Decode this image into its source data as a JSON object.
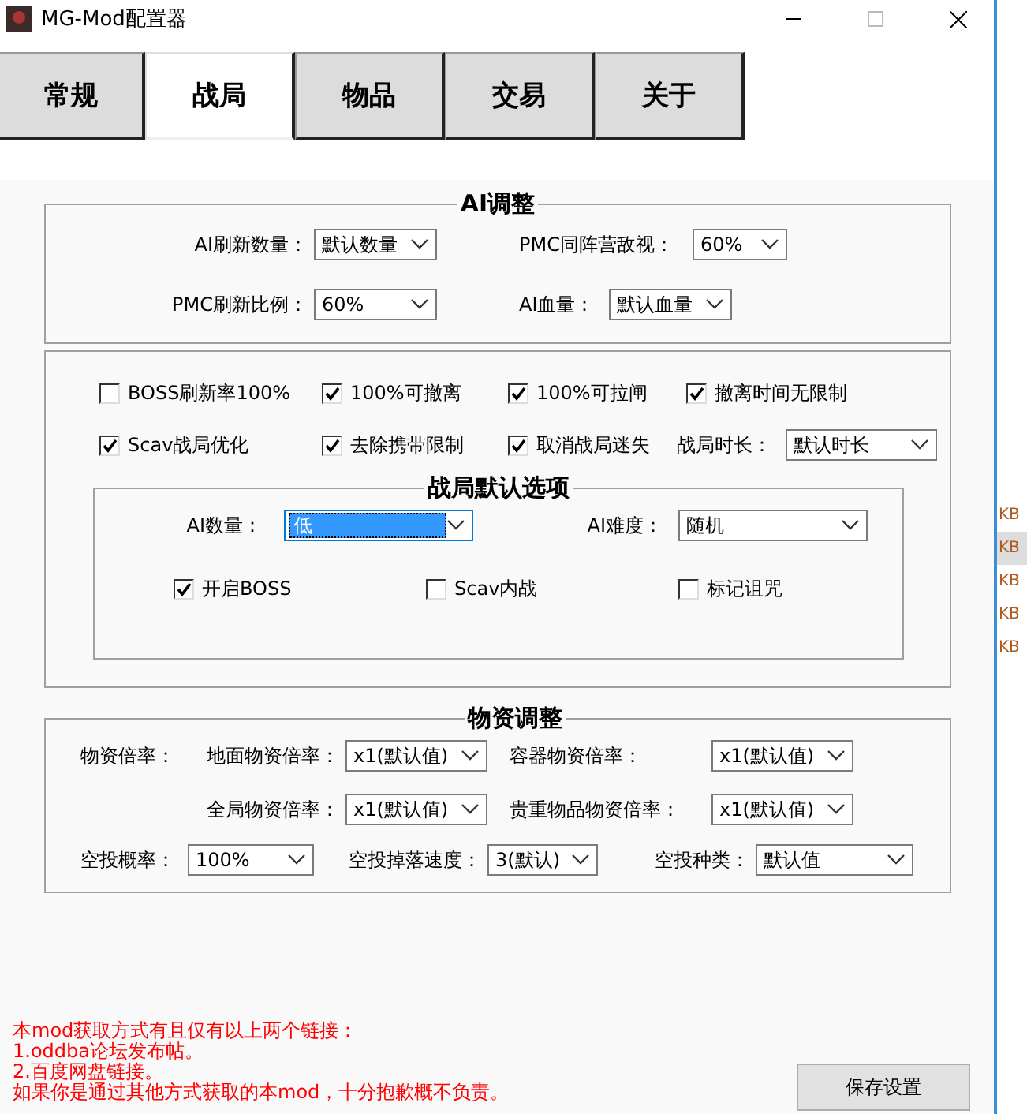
{
  "window": {
    "title": "MG-Mod配置器"
  },
  "tabs": [
    {
      "label": "常规",
      "selected": false
    },
    {
      "label": "战局",
      "selected": true
    },
    {
      "label": "物品",
      "selected": false
    },
    {
      "label": "交易",
      "selected": false
    },
    {
      "label": "关于",
      "selected": false
    }
  ],
  "ai_group": {
    "title": "AI调整",
    "fields": [
      {
        "label": "AI刷新数量：",
        "value": "默认数量"
      },
      {
        "label": "PMC同阵营敌视：",
        "value": "60%"
      },
      {
        "label": "PMC刷新比例：",
        "value": "60%"
      },
      {
        "label": "AI血量：",
        "value": "默认血量"
      }
    ]
  },
  "options_group": {
    "checkboxes": [
      {
        "label": "BOSS刷新率100%",
        "checked": false
      },
      {
        "label": "100%可撤离",
        "checked": true
      },
      {
        "label": "100%可拉闸",
        "checked": true
      },
      {
        "label": "撤离时间无限制",
        "checked": true
      },
      {
        "label": "Scav战局优化",
        "checked": true
      },
      {
        "label": "去除携带限制",
        "checked": true
      },
      {
        "label": "取消战局迷失",
        "checked": true
      }
    ],
    "duration": {
      "label": "战局时长：",
      "value": "默认时长"
    },
    "defaults": {
      "title": "战局默认选项",
      "fields": [
        {
          "label": "AI数量：",
          "value": "低",
          "focused": true
        },
        {
          "label": "AI难度：",
          "value": "随机",
          "focused": false
        }
      ],
      "checkboxes": [
        {
          "label": "开启BOSS",
          "checked": true
        },
        {
          "label": "Scav内战",
          "checked": false
        },
        {
          "label": "标记诅咒",
          "checked": false
        }
      ]
    }
  },
  "supplies_group": {
    "title": "物资调整",
    "section_label": "物资倍率：",
    "rates": [
      {
        "label": "地面物资倍率：",
        "value": "x1(默认值)"
      },
      {
        "label": "容器物资倍率：",
        "value": "x1(默认值)"
      },
      {
        "label": "全局物资倍率：",
        "value": "x1(默认值)"
      },
      {
        "label": "贵重物品物资倍率：",
        "value": "x1(默认值)"
      }
    ],
    "airdrop": [
      {
        "label": "空投概率：",
        "value": "100%"
      },
      {
        "label": "空投掉落速度：",
        "value": "3(默认)"
      },
      {
        "label": "空投种类：",
        "value": "默认值"
      }
    ]
  },
  "notice": [
    "本mod获取方式有且仅有以上两个链接：",
    "1.oddba论坛发布帖。",
    "2.百度网盘链接。",
    "如果你是通过其他方式获取的本mod，十分抱歉概不负责。"
  ],
  "save_button": "保存设置",
  "background_list": [
    {
      "label": "KB",
      "selected": false
    },
    {
      "label": "KB",
      "selected": true
    },
    {
      "label": "KB",
      "selected": false
    },
    {
      "label": "KB",
      "selected": false
    },
    {
      "label": "KB",
      "selected": false
    }
  ]
}
